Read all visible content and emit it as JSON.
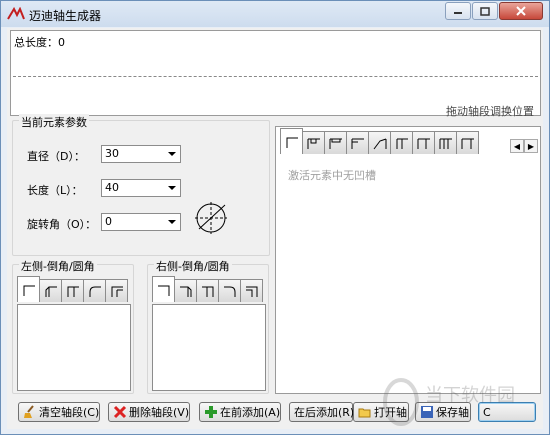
{
  "window": {
    "title": "迈迪轴生成器"
  },
  "top": {
    "total_length": "总长度：0",
    "drag_hint": "拖动轴段调换位置"
  },
  "params": {
    "title": "当前元素参数",
    "diameter_label": "直径（D）：",
    "diameter_value": "30",
    "length_label": "长度（L）：",
    "length_value": "40",
    "rotation_label": "旋转角（O）：",
    "rotation_value": "0"
  },
  "left_chamfer": {
    "title": "左侧-倒角/圆角"
  },
  "right_chamfer": {
    "title": "右侧-倒角/圆角"
  },
  "element_panel": {
    "inactive_message": "激活元素中无凹槽"
  },
  "buttons": {
    "clear": "清空轴段(C)",
    "delete": "删除轴段(V)",
    "add_before": "在前添加(A)",
    "add_after": "在后添加(R)",
    "open": "打开轴",
    "save": "保存轴",
    "extra": "C"
  },
  "watermark": {
    "text": "当下软件园"
  },
  "colors": {
    "accent": "#3c7fb1",
    "panel_border": "#9a9a9a",
    "disabled_text": "#a0a0a0"
  },
  "icons": [
    "app-logo-icon",
    "minimize-icon",
    "maximize-icon",
    "close-icon",
    "chevron-down-icon",
    "circle-rotation-icon",
    "broom-icon",
    "delete-x-icon",
    "plus-icon",
    "folder-open-icon",
    "save-disk-icon"
  ]
}
